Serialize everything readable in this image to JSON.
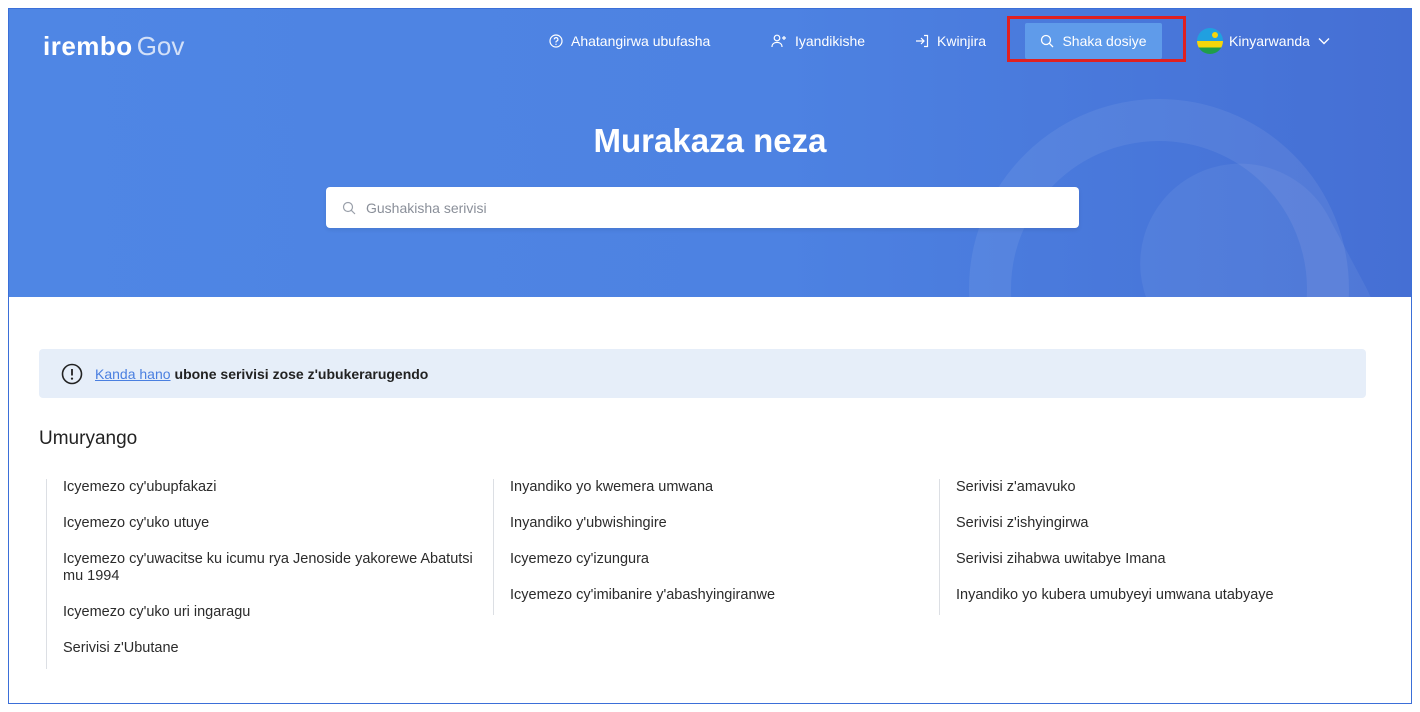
{
  "header": {
    "logo_brand": "irembo",
    "logo_suffix": "Gov",
    "nav": {
      "help": "Ahatangirwa ubufasha",
      "register": "Iyandikishe",
      "login": "Kwinjira",
      "track": "Shaka dosiye",
      "language": "Kinyarwanda"
    }
  },
  "hero": {
    "title": "Murakaza neza",
    "search_placeholder": "Gushakisha serivisi"
  },
  "notice": {
    "link": "Kanda hano",
    "text": "ubone serivisi zose z'ubukerarugendo"
  },
  "section": {
    "title": "Umuryango",
    "columns": [
      [
        "Icyemezo cy'ubupfakazi",
        "Icyemezo cy'uko utuye",
        "Icyemezo cy'uwacitse ku icumu rya Jenoside yakorewe Abatutsi mu 1994",
        "Icyemezo cy'uko uri ingaragu",
        "Serivisi z'Ubutane"
      ],
      [
        "Inyandiko yo kwemera umwana",
        "Inyandiko y'ubwishingire",
        "Icyemezo cy'izungura",
        "Icyemezo cy'imibanire y'abashyingiranwe"
      ],
      [
        "Serivisi z'amavuko",
        "Serivisi z'ishyingirwa",
        "Serivisi zihabwa uwitabye Imana",
        "Inyandiko yo kubera umubyeyi umwana utabyaye"
      ]
    ]
  },
  "colors": {
    "hero_blue": "#4f86e4",
    "track_button": "#5f9bea",
    "highlight_red": "#e02020",
    "notice_bg": "#e6eef9",
    "link": "#4a7fe0"
  }
}
